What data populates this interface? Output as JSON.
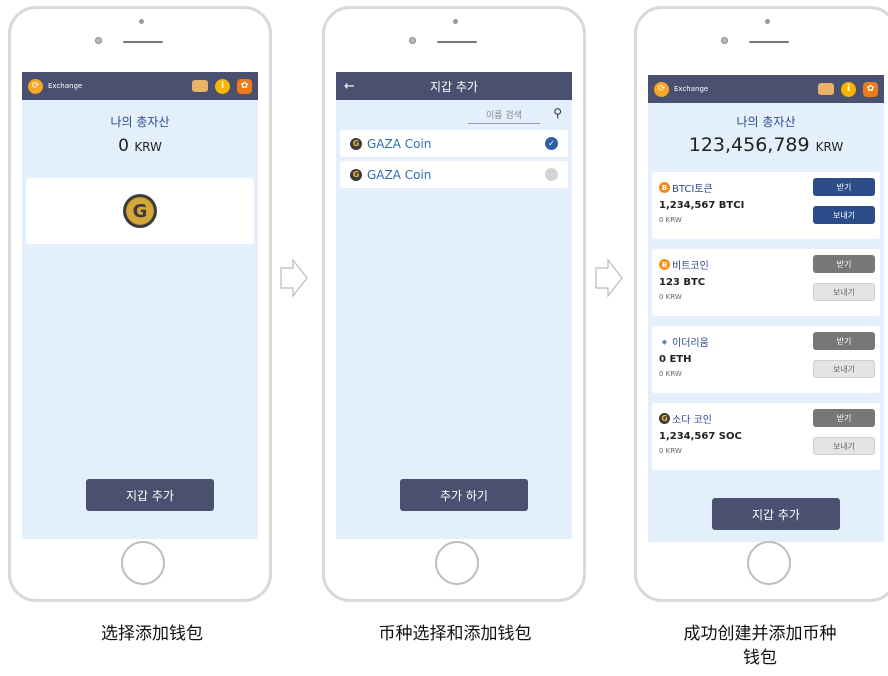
{
  "app": {
    "title": "Exchange"
  },
  "screen1": {
    "total_label": "나의 총자산",
    "total_value": "0",
    "total_unit": "KRW",
    "add_wallet_button": "지갑 추가"
  },
  "screen2": {
    "title": "지갑 추가",
    "back_icon": "←",
    "search_placeholder": "이름 검색",
    "coins": [
      {
        "name": "GAZA Coin",
        "checked": true
      },
      {
        "name": "GAZA Coin",
        "checked": false
      }
    ],
    "add_button": "추가 하기"
  },
  "screen3": {
    "total_label": "나의 총자산",
    "total_value": "123,456,789",
    "total_unit": "KRW",
    "assets": [
      {
        "name": "BTCI토큰",
        "amount": "1,234,567 BTCI",
        "krw": "0 KRW",
        "receive": "받기",
        "send": "보내기",
        "icon_color": "#f08c1c"
      },
      {
        "name": "비트코인",
        "amount": "123 BTC",
        "krw": "0 KRW",
        "receive": "받기",
        "send": "보내기",
        "icon_color": "#f7931a"
      },
      {
        "name": "이더리움",
        "amount": "0 ETH",
        "krw": "0 KRW",
        "receive": "받기",
        "send": "보내기",
        "icon_color": "#6b7fc4"
      },
      {
        "name": "소다 코인",
        "amount": "1,234,567 SOC",
        "krw": "0 KRW",
        "receive": "받기",
        "send": "보내기",
        "icon_color": "#3b3b3b"
      }
    ],
    "add_wallet_button": "지갑 추가"
  },
  "captions": {
    "step1": "选择添加钱包",
    "step2": "币种选择和添加钱包",
    "step3_line1": "成功创建并添加币种",
    "step3_line2": "钱包"
  },
  "colors": {
    "appbar": "#4a5170",
    "screen_bg": "#e3f0fb",
    "accent_blue": "#2d4d8a"
  }
}
